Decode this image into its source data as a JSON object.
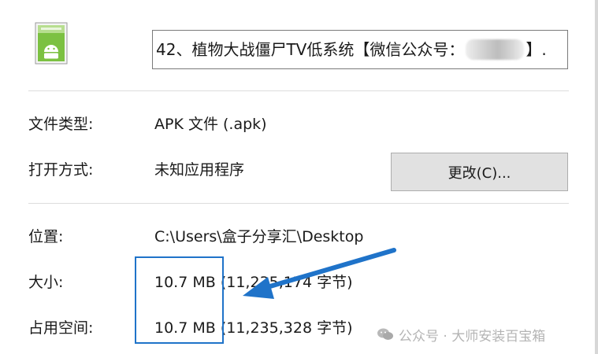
{
  "header": {
    "file_name": "42、植物大战僵尸TV低系统【微信公众号：",
    "file_name_end": "】.",
    "icon": "android-apk-file-icon"
  },
  "properties": {
    "file_type_label": "文件类型:",
    "file_type_value": "APK 文件 (.apk)",
    "opens_with_label": "打开方式:",
    "opens_with_value": "未知应用程序",
    "change_button": "更改(C)...",
    "location_label": "位置:",
    "location_value": "C:\\Users\\盒子分享汇\\Desktop",
    "size_label": "大小:",
    "size_value": "10.7 MB",
    "size_bytes": "(11,235,174 字节)",
    "size_on_disk_label": "占用空间:",
    "size_on_disk_value": "10.7 MB",
    "size_on_disk_bytes": "(11,235,328 字节)"
  },
  "annotation": {
    "color": "#1f73c9"
  },
  "watermark": {
    "text": "公众号 · 大师安装百宝箱",
    "icon": "wechat-icon"
  }
}
